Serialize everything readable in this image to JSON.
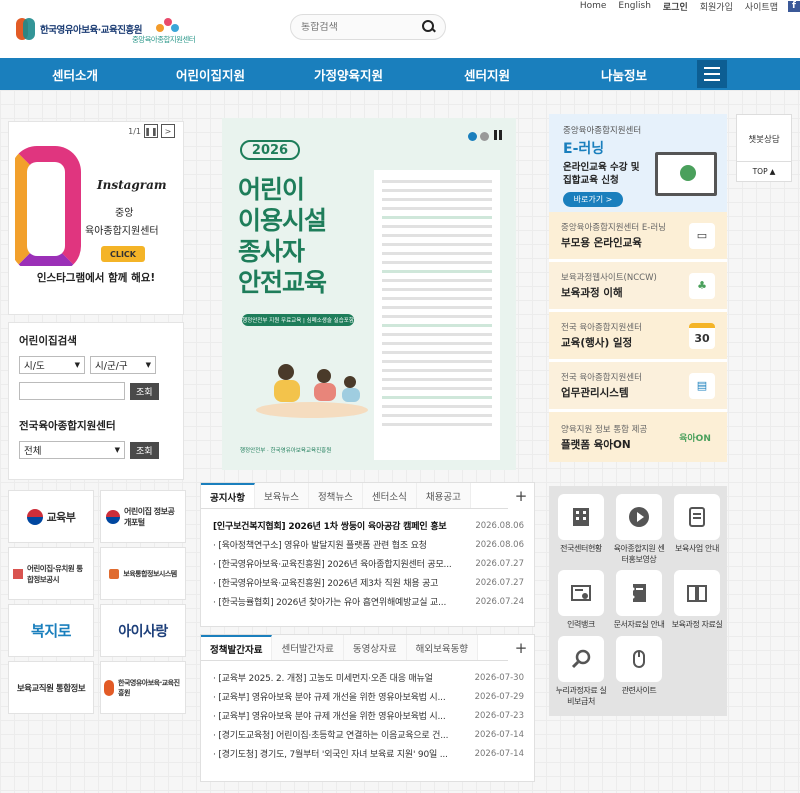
{
  "util_links": {
    "home": "Home",
    "english": "English",
    "login": "로그인",
    "join": "회원가입",
    "sitemap": "사이트맵",
    "facebook": "f"
  },
  "logos": {
    "primary": "한국영유아보육·교육진흥원",
    "secondary": "중앙육아종합지원센터"
  },
  "search": {
    "placeholder": "통합검색"
  },
  "nav": [
    "센터소개",
    "어린이집지원",
    "가정양육지원",
    "센터지원",
    "나눔정보"
  ],
  "instagram": {
    "pager": "1/1",
    "brand": "Instagram",
    "line1": "중앙",
    "line2": "육아종합지원센터",
    "click": "CLICK",
    "caption": "인스타그램에서 함께 해요!"
  },
  "daycare_search": {
    "title": "어린이집검색",
    "sido": "시/도",
    "sigungu": "시/군/구",
    "search_btn": "조회"
  },
  "center_search": {
    "title": "전국육아종합지원센터",
    "select": "전체",
    "search_btn": "조회"
  },
  "left_banners": [
    {
      "label": "교육부"
    },
    {
      "label": "어린이집 정보공개포털"
    },
    {
      "label": "어린이집·유치원 통합정보공시"
    },
    {
      "label": "보육통합정보시스템"
    },
    {
      "label": "복지로"
    },
    {
      "label": "아이사랑"
    },
    {
      "label": "보육교직원 통합정보"
    },
    {
      "label": "한국영유아보육·교육진흥원"
    }
  ],
  "poster": {
    "year": "2026",
    "title_lines": [
      "어린이",
      "이용시설",
      "종사자",
      "안전교육"
    ],
    "pill": "행정안전부 지원 무료교육 | 심폐소생술 실습포함",
    "footer": "행정안전부 · 한국영유아보육교육진흥원"
  },
  "board1": {
    "tabs": [
      "공지사항",
      "보육뉴스",
      "정책뉴스",
      "센터소식",
      "채용공고"
    ],
    "posts": [
      {
        "title": "[인구보건복지협회] 2026년 1차 쌍둥이 육아공감 캠페인 홍보",
        "date": "2026.08.06"
      },
      {
        "title": "[육아정책연구소] 영유아 발달지원 플랫폼 관련 협조 요청",
        "date": "2026.08.06"
      },
      {
        "title": "[한국영유아보육·교육진흥원] 2026년 육아종합지원센터 공모...",
        "date": "2026.07.27"
      },
      {
        "title": "[한국영유아보육·교육진흥원] 2026년 제3차 직원 채용 공고",
        "date": "2026.07.27"
      },
      {
        "title": "[한국능률협회] 2026년 찾아가는 유아 흡연위해예방교실 교...",
        "date": "2026.07.24"
      }
    ]
  },
  "board2": {
    "tabs": [
      "정책발간자료",
      "센터발간자료",
      "동영상자료",
      "해외보육동향"
    ],
    "posts": [
      {
        "title": "[교육부 2025. 2. 개정] 고농도 미세먼지·오존 대응 매뉴얼",
        "date": "2026-07-30"
      },
      {
        "title": "[교육부] 영유아보육 분야 규제 개선을 위한 영유아보육법 시...",
        "date": "2026-07-29"
      },
      {
        "title": "[교육부] 영유아보육 분야 규제 개선을 위한 영유아보육법 시...",
        "date": "2026-07-23"
      },
      {
        "title": "[경기도교육청] 어린이집·초등학교 연결하는 이음교육으로 건...",
        "date": "2026-07-14"
      },
      {
        "title": "[경기도청] 경기도, 7월부터 '외국인 자녀 보육료 지원' 90일 ...",
        "date": "2026-07-14"
      }
    ]
  },
  "elearning": {
    "small": "중앙육아종합지원센터",
    "big": "E-러닝",
    "desc1": "온라인교육 수강 및",
    "desc2": "집합교육 신청",
    "go": "바로가기 >"
  },
  "promos": [
    {
      "small": "중앙육아종합지원센터 E-러닝",
      "big": "부모용 온라인교육",
      "bg": "#fcefd6"
    },
    {
      "small": "보육과정웹사이트(NCCW)",
      "big": "보육과정 이해",
      "bg": "#fbf0dc"
    },
    {
      "small": "전국 육아종합지원센터",
      "big": "교육(행사) 일정",
      "bg": "#fcefd6",
      "icon": "30"
    },
    {
      "small": "전국 육아종합지원센터",
      "big": "업무관리시스템",
      "bg": "#fbf0dc"
    },
    {
      "small": "양육지원 정보 통합 제공",
      "big": "플랫폼 육아ON",
      "bg": "#fcefd6",
      "icon": "육아ON"
    }
  ],
  "quick_links": [
    {
      "label": "전국센터현황",
      "icon": "building-icon"
    },
    {
      "label": "육아종합지원 센터홍보영상",
      "icon": "play-icon"
    },
    {
      "label": "보육사업 안내",
      "icon": "document-icon"
    },
    {
      "label": "인력뱅크",
      "icon": "certificate-icon"
    },
    {
      "label": "문서자료실 안내",
      "icon": "binder-icon"
    },
    {
      "label": "보육과정 자료실",
      "icon": "book-icon"
    },
    {
      "label": "누리과정자료 실비보급처",
      "icon": "magnifier-icon"
    },
    {
      "label": "관련사이트",
      "icon": "mouse-icon"
    }
  ],
  "side_right": {
    "chatbot": "챗봇상담",
    "top": "TOP"
  },
  "colors": {
    "brand_blue": "#1a7fbd",
    "brand_green": "#1e7d5a",
    "accent_pink": "#e0357f"
  }
}
